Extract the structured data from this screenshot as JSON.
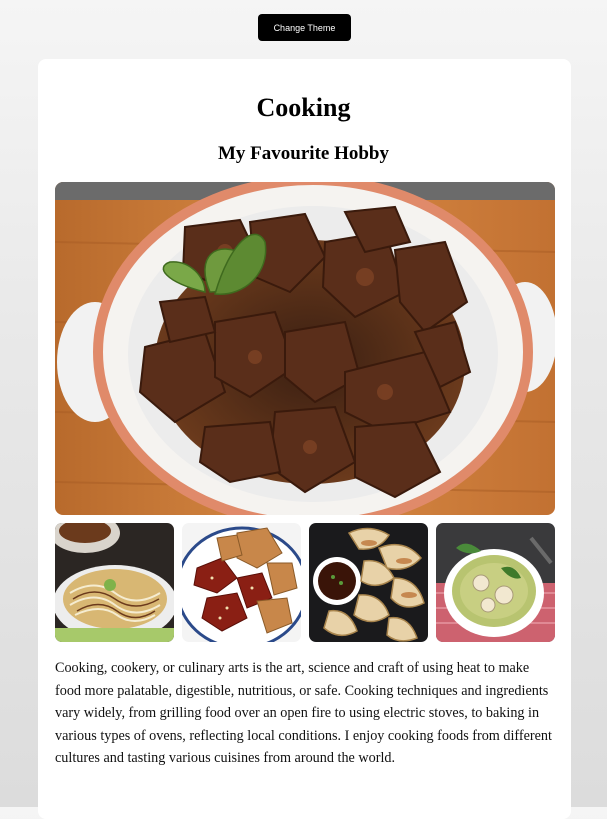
{
  "toolbar": {
    "theme_button_label": "Change Theme"
  },
  "page": {
    "title": "Cooking",
    "subtitle": "My Favourite Hobby",
    "description": "Cooking, cookery, or culinary arts is the art, science and craft of using heat to make food more palatable, digestible, nutritious, or safe. Cooking techniques and ingredients vary widely, from grilling food over an open fire to using electric stoves, to baking in various types of ovens, reflecting local conditions. I enjoy cooking foods from different cultures and tasting various cuisines from around the world."
  },
  "gallery": {
    "hero": "beef-stew-photo",
    "thumbnails": [
      "okonomiyaki-photo",
      "fried-chicken-photo",
      "dumplings-photo",
      "green-curry-photo"
    ]
  },
  "colors": {
    "button_bg": "#000000",
    "card_bg": "#ffffff",
    "text": "#111111"
  }
}
